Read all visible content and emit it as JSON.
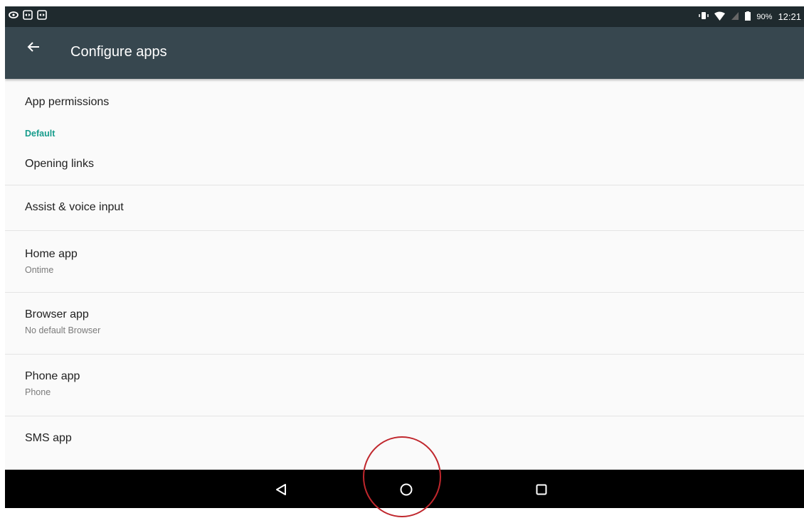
{
  "status_bar": {
    "left_icons": [
      "eye-icon",
      "teamviewer-icon",
      "teamviewer-icon"
    ],
    "right_icons": [
      "vibrate-icon",
      "wifi-icon",
      "no-sim-icon",
      "battery-icon"
    ],
    "battery": "90%",
    "time": "12:21"
  },
  "app_bar": {
    "title": "Configure apps",
    "back_icon": "arrow-back-icon"
  },
  "list": {
    "app_permissions": "App permissions",
    "default_header": "Default",
    "opening_links": "Opening links",
    "assist_voice": "Assist & voice input",
    "home_app": {
      "label": "Home app",
      "summary": "Ontime"
    },
    "browser_app": {
      "label": "Browser app",
      "summary": "No default Browser"
    },
    "phone_app": {
      "label": "Phone app",
      "summary": "Phone"
    },
    "sms_app": "SMS app"
  },
  "nav_bar": {
    "icons": [
      "back-triangle-icon",
      "home-circle-icon",
      "recents-square-icon"
    ]
  },
  "colors": {
    "status_bar": "#1f2a2e",
    "app_bar": "#37474f",
    "accent": "#179c8c",
    "annotation": "#c0272d"
  }
}
